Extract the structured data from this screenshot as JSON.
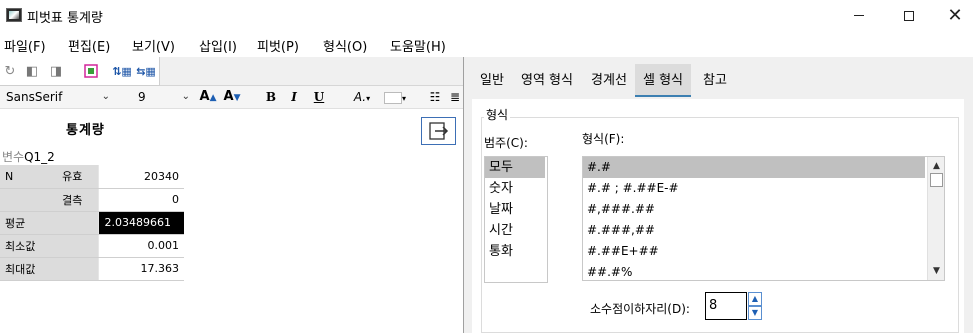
{
  "window": {
    "title": "피벗표 통계량"
  },
  "menu": [
    "파일(F)",
    "편집(E)",
    "보기(V)",
    "삽입(I)",
    "피벗(P)",
    "형식(O)",
    "도움말(H)"
  ],
  "toolbar": {
    "font_name": "SansSerif",
    "font_size": "9",
    "bold": "B",
    "italic": "I",
    "underline": "U",
    "grow_font": "A",
    "shrink_font": "A"
  },
  "statistics": {
    "title": "통계량",
    "variable_prefix": "변수",
    "variable_name": "Q1_2",
    "rows": [
      {
        "h1": "N",
        "h2": "유효",
        "value": "20340"
      },
      {
        "h1": "",
        "h2": "결측",
        "value": "0"
      },
      {
        "h1": "평균",
        "h2": "",
        "value": "2.03489661"
      },
      {
        "h1": "최소값",
        "h2": "",
        "value": "0.001"
      },
      {
        "h1": "최대값",
        "h2": "",
        "value": "17.363"
      }
    ]
  },
  "tabs": [
    "일반",
    "영역 형식",
    "경계선",
    "셀 형식",
    "참고"
  ],
  "active_tab": "셀 형식",
  "format_group": {
    "title": "형식",
    "category_label": "범주(C):",
    "format_label": "형식(F):",
    "categories": [
      "모두",
      "숫자",
      "날짜",
      "시간",
      "통화"
    ],
    "selected_category": "모두",
    "formats": [
      "#.#",
      "#.# ; #.##E-#",
      "#,###.##",
      "#.###,##",
      "#.##E+##",
      "##.#%"
    ],
    "selected_format": "#.#",
    "decimal_label": "소수점이하자리(D):",
    "decimal_value": "8"
  }
}
